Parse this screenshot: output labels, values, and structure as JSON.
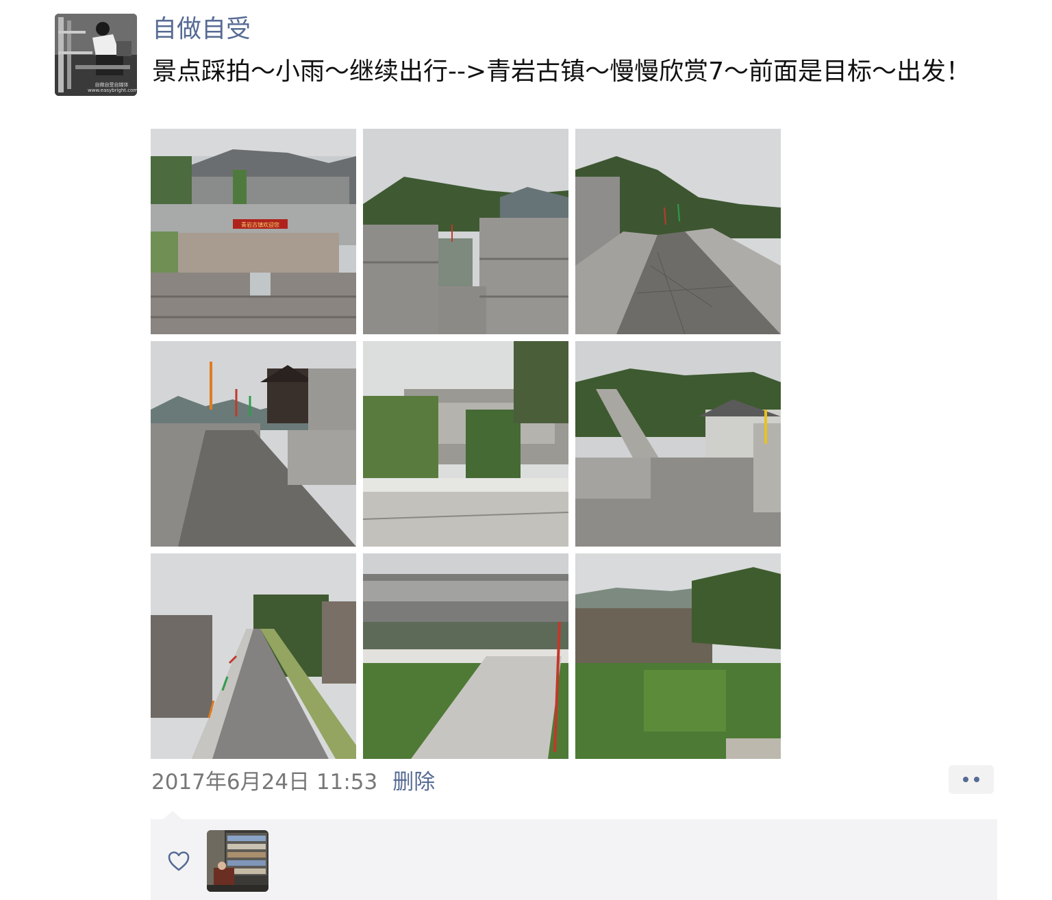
{
  "post": {
    "author": "自做自受",
    "text": "景点踩拍～小雨～继续出行-->青岩古镇～慢慢欣赏7～前面是目标～出发！",
    "avatar_watermark": "自做自受自媒体 www.easybright.com",
    "photos": [
      {
        "id": "photo-1",
        "sign_text": "青岩古镇欢迎您"
      },
      {
        "id": "photo-2"
      },
      {
        "id": "photo-3"
      },
      {
        "id": "photo-4"
      },
      {
        "id": "photo-5"
      },
      {
        "id": "photo-6"
      },
      {
        "id": "photo-7"
      },
      {
        "id": "photo-8"
      },
      {
        "id": "photo-9"
      }
    ],
    "timestamp": "2017年6月24日 11:53",
    "delete_label": "删除"
  },
  "likes": {
    "icon": "heart-icon",
    "users": [
      {
        "avatar": "library-photo"
      }
    ]
  },
  "colors": {
    "link": "#566b94",
    "timestamp": "#777777",
    "panel_bg": "#f3f3f5"
  }
}
